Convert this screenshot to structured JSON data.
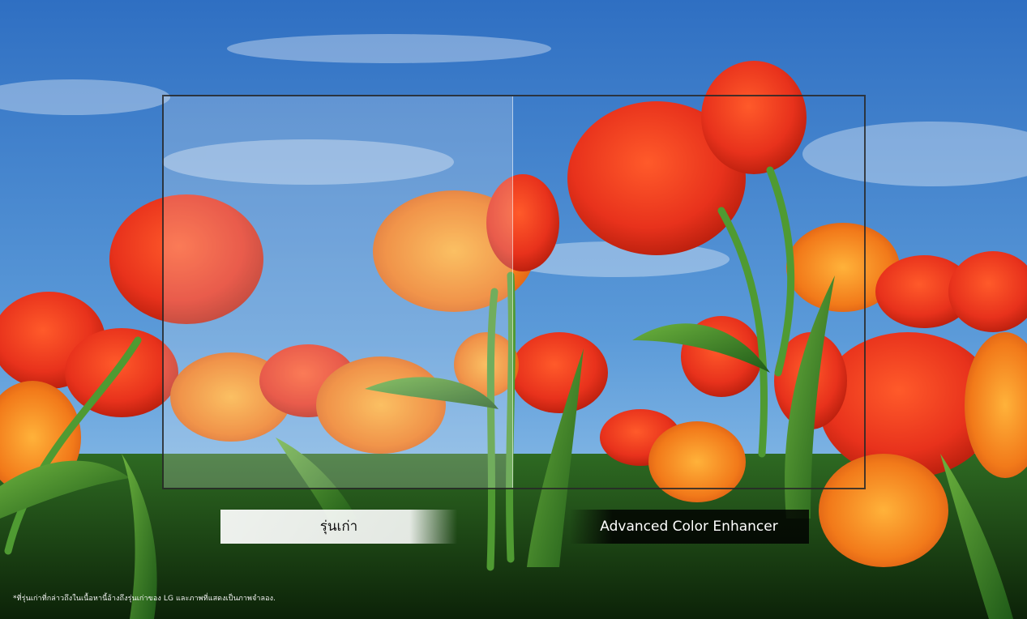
{
  "labels": {
    "old": "รุ่นเก่า",
    "new": "Advanced Color Enhancer"
  },
  "disclaimer": "*ที่รุ่นเก่าที่กล่าวถึงในเนื้อหานี้อ้างถึงรุ่นเก่าของ LG และภาพที่แสดงเป็นภาพจำลอง.",
  "colors": {
    "sky_top": "#2f6fc2",
    "sky_bottom": "#9fcdf0",
    "petal_red": "#e8321c",
    "petal_orange": "#f5891e",
    "leaf_green": "#3e8a2c"
  }
}
